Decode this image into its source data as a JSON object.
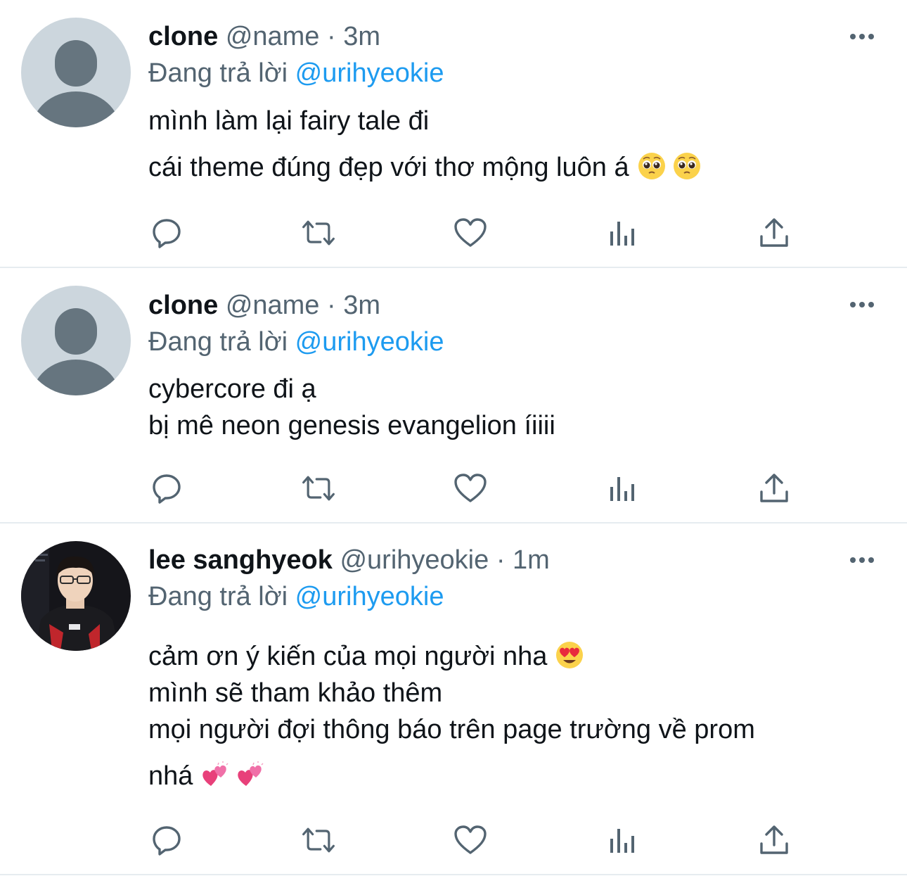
{
  "colors": {
    "text_primary": "#0f1419",
    "text_secondary": "#536471",
    "mention_blue": "#1d9bf0",
    "divider": "#e6ecf0",
    "default_avatar_bg": "#ccd6dd",
    "default_avatar_fg": "#66757f"
  },
  "reply_prefix": "Đang trả lời",
  "separator": "·",
  "action_icons": [
    "reply-icon",
    "retweet-icon",
    "like-icon",
    "views-icon",
    "share-icon"
  ],
  "tweets": [
    {
      "display_name": "clone",
      "handle": "@name",
      "time": "3m",
      "replying_to": "@urihyeokie",
      "avatar": "default-avatar-icon",
      "lines": [
        "mình làm lại fairy tale đi",
        "cái theme đúng đẹp với thơ mộng luôn á"
      ],
      "emojis": [
        "pleading-face-emoji",
        "pleading-face-emoji"
      ]
    },
    {
      "display_name": "clone",
      "handle": "@name",
      "time": "3m",
      "replying_to": "@urihyeokie",
      "avatar": "default-avatar-icon",
      "lines": [
        "cybercore đi ạ",
        "bị mê neon genesis evangelion íiiii"
      ]
    },
    {
      "display_name": "lee sanghyeok",
      "handle": "@urihyeokie",
      "time": "1m",
      "replying_to": "@urihyeokie",
      "avatar": "profile-photo",
      "lines": [
        "cảm ơn ý kiến của mọi người nha",
        "mình sẽ tham khảo thêm",
        "mọi người đợi thông báo trên page trường về prom",
        "nhá"
      ],
      "emojis": [
        "heart-eyes-emoji",
        "two-hearts-emoji",
        "two-hearts-emoji"
      ]
    }
  ]
}
